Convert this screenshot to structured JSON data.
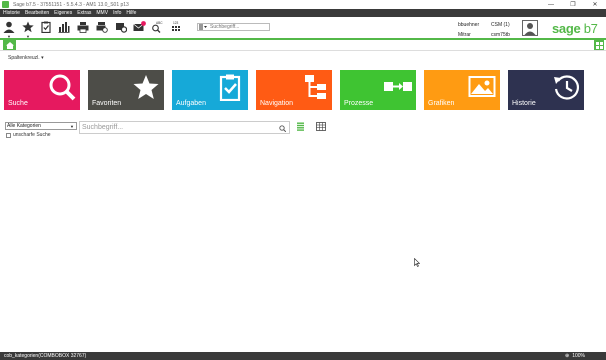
{
  "window": {
    "title": "Sage b7.5 - 37551151 - 5.5.4.3 - AM1 13.0_S01 p13",
    "minimize": "—",
    "restore": "❐",
    "close": "✕"
  },
  "menu": [
    "Historie",
    "Bearbeiten",
    "Eigenes",
    "Extras",
    "MMV",
    "Info",
    "Hilfe"
  ],
  "toolbar": {
    "search_placeholder": "Suchbegriff...",
    "user_name": "bbuehner",
    "user_id": "Mitrar",
    "system": "CSM (1)",
    "server": "csm75tb",
    "icons": [
      "user-icon",
      "favorites-icon",
      "tasks-icon",
      "chart-icon",
      "print-icon",
      "print-preview-icon",
      "settings-icon",
      "mail-icon",
      "spellcheck-icon",
      "numbering-icon"
    ]
  },
  "brand": {
    "name": "sage",
    "version": "b7",
    "color": "#53b848"
  },
  "subbar": {
    "label": "Spaltenkreuzl."
  },
  "tiles": [
    {
      "label": "Suche",
      "color": "#e6195f",
      "icon": "search-icon"
    },
    {
      "label": "Favoriten",
      "color": "#4d4d48",
      "icon": "star-icon"
    },
    {
      "label": "Aufgaben",
      "color": "#16a9d8",
      "icon": "clipboard-check-icon"
    },
    {
      "label": "Navigation",
      "color": "#ff5b14",
      "icon": "hierarchy-icon"
    },
    {
      "label": "Prozesse",
      "color": "#3fc432",
      "icon": "process-flow-icon"
    },
    {
      "label": "Grafiken",
      "color": "#ff9b12",
      "icon": "image-icon"
    },
    {
      "label": "Historie",
      "color": "#2e3250",
      "icon": "history-clock-icon"
    }
  ],
  "search": {
    "category": "Alle Kategorien",
    "fuzzy_label": "unscharfe Suche",
    "placeholder": "Suchbegriff..."
  },
  "statusbar": {
    "text": "cob_kategorien(COMBOBOX 32767)",
    "zoom": "100%"
  }
}
